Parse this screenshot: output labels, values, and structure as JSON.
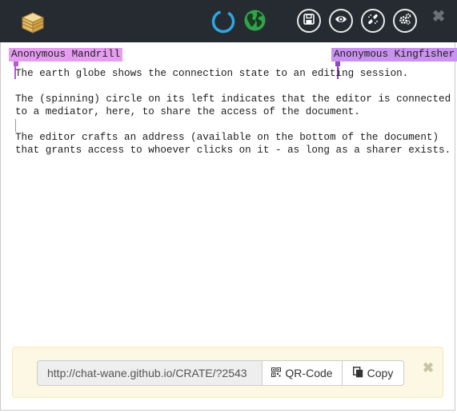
{
  "toolbar": {
    "icons": [
      "crate-logo-icon",
      "connection-spinner-icon",
      "globe-icon",
      "save-icon",
      "eye-icon",
      "unlink-icon",
      "gears-icon",
      "close-icon"
    ]
  },
  "editor": {
    "lines": [
      "The earth globe shows the connection state to an editing session.",
      "",
      "The (spinning) circle on its left indicates that the editor is connected",
      "to a mediator, here, to share the access of the document.",
      "",
      "The editor crafts an address (available on the bottom of the document)",
      "that grants access to whoever clicks on it - as long as a sharer exists."
    ],
    "cursors": [
      {
        "user": "Anonymous Mandrill",
        "color": "#e59df0"
      },
      {
        "user": "Anonymous Kingfisher",
        "color": "#c992f0"
      }
    ]
  },
  "share": {
    "url": "http://chat-wane.github.io/CRATE/?2543",
    "qr_label": "QR-Code",
    "copy_label": "Copy"
  },
  "colors": {
    "toolbar_bg": "#262b31",
    "spinner": "#2aa7e6",
    "globe": "#32a34b",
    "footer_bg": "#fcf8e3"
  }
}
